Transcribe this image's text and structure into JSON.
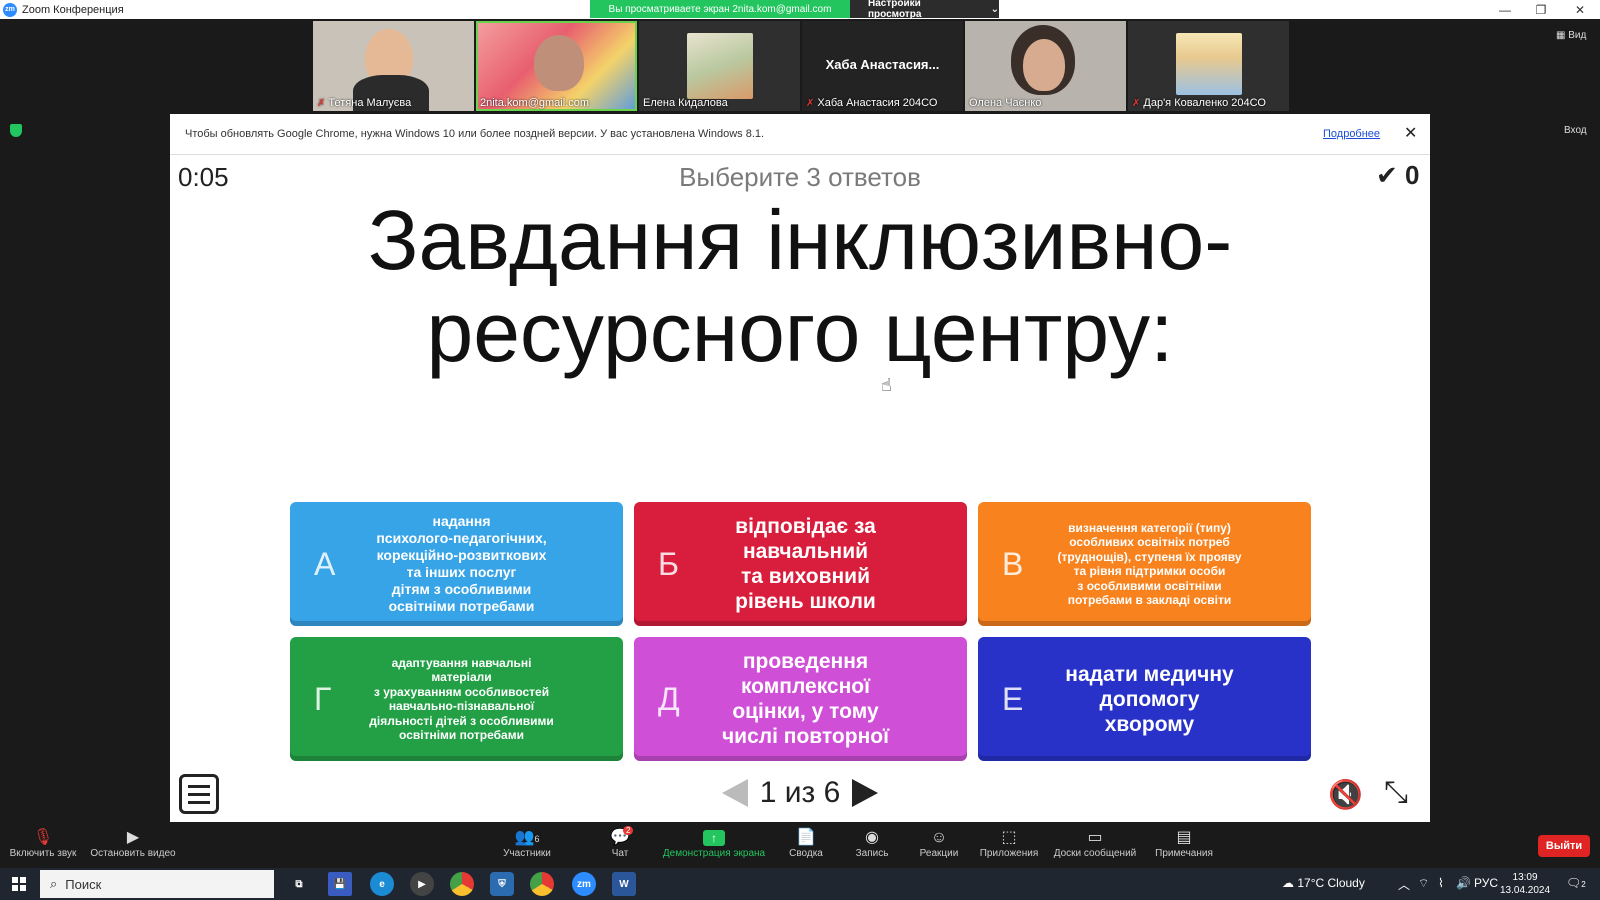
{
  "window": {
    "app_title": "Zoom Конференция",
    "share_banner": "Вы просматриваете экран 2nita.kom@gmail.com",
    "view_options": "Настройки просмотра",
    "view_label": "Вид",
    "enter_label": "Вход"
  },
  "participants": [
    {
      "name": "Тетяна Малуєва",
      "muted": true
    },
    {
      "name": "2nita.kom@gmail.com",
      "muted": false
    },
    {
      "name": "Елена Кидалова",
      "muted": false
    },
    {
      "name": "Хаба Анастасия 204СО",
      "muted": true,
      "center_label": "Хаба  Анастасия..."
    },
    {
      "name": "Олена Чаєнко",
      "muted": false
    },
    {
      "name": "Дар'я Коваленко 204СО",
      "muted": true
    }
  ],
  "notice": {
    "text": "Чтобы обновлять Google Chrome, нужна Windows 10 или более поздней версии. У вас установлена Windows 8.1.",
    "link": "Подробнее",
    "close": "✕"
  },
  "quiz": {
    "timer": "0:05",
    "instruction": "Выберите 3 ответов",
    "score_mark": "✔",
    "score": "0",
    "question": "Завдання інклюзивно-ресурсного центру:",
    "answers": [
      {
        "letter": "А",
        "text": "надання\nпсихолого-педагогічних,\nкорекційно-розвиткових\nта інших послуг\nдітям з особливими\nосвітніми потребами",
        "color": "#38a4e8"
      },
      {
        "letter": "Б",
        "text": "відповідає за\nнавчальний\nта виховний\nрівень школи",
        "color": "#d81e3c"
      },
      {
        "letter": "В",
        "text": "визначення категорії (типу)\nособливих освітніх потреб\n(труднощів), ступеня їх прояву\nта рівня підтримки особи\nз особливими освітніми\nпотребами в закладі освіти",
        "color": "#f7821e"
      },
      {
        "letter": "Г",
        "text": "адаптування навчальні\nматеріали\nз урахуванням особливостей\nнавчально-пізнавальної\nдіяльності дітей з особливими\nосвітніми потребами",
        "color": "#23a046"
      },
      {
        "letter": "Д",
        "text": "проведення\nкомплексної\nоцінки, у тому\nчислі повторної",
        "color": "#cf4fd6"
      },
      {
        "letter": "Е",
        "text": "надати медичну\nдопомогу\nхворому",
        "color": "#2832c8"
      }
    ],
    "pager": "1 из 6"
  },
  "toolbar": {
    "unmute": "Включить звук",
    "stop_video": "Остановить видео",
    "participants": "Участники",
    "participants_count": "6",
    "chat": "Чат",
    "chat_badge": "2",
    "share": "Демонстрация экрана",
    "summary": "Сводка",
    "record": "Запись",
    "reactions": "Реакции",
    "apps": "Приложения",
    "whiteboards": "Доски сообщений",
    "notes": "Примечания",
    "leave": "Выйти"
  },
  "taskbar": {
    "search_placeholder": "Поиск",
    "weather": "17°C  Cloudy",
    "lang": "РУС",
    "time": "13:09",
    "date": "13.04.2024",
    "notif_count": "2"
  }
}
